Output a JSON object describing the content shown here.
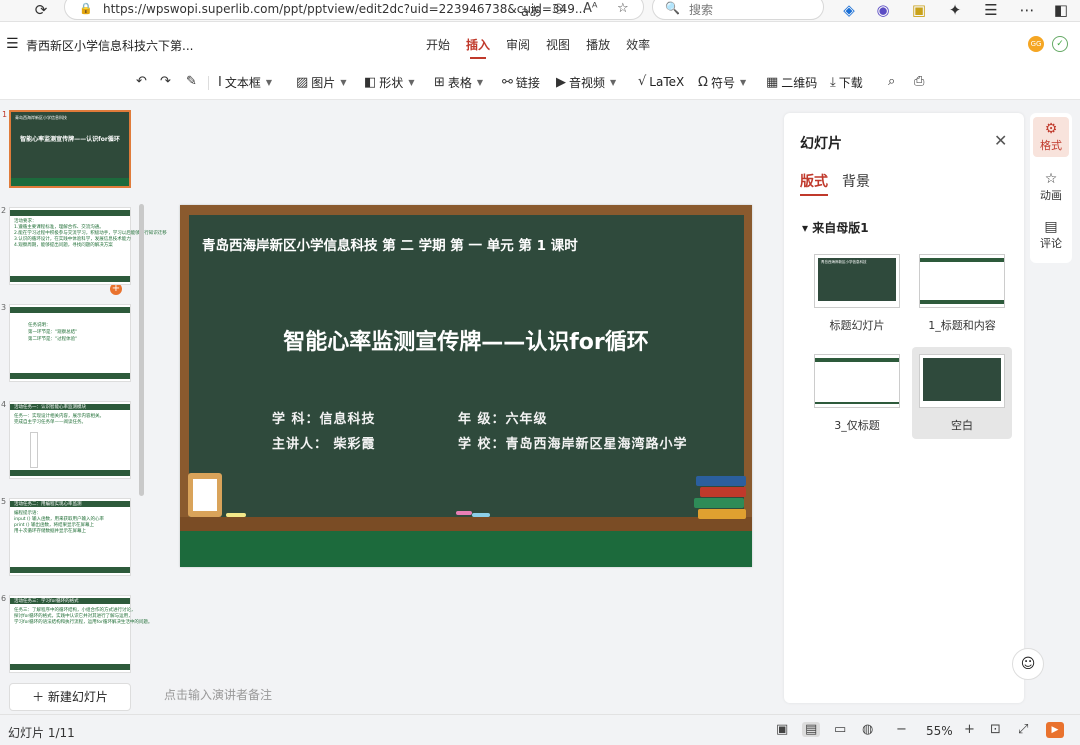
{
  "browser": {
    "url": "https://wpswopi.superlib.com/ppt/pptview/edit2dc?uid=223946738&cuid=349...",
    "search_placeholder": "搜索",
    "read_aloud": "aあ"
  },
  "app": {
    "doc_title": "青西新区小学信息科技六下第...",
    "tabs": [
      {
        "label": "开始"
      },
      {
        "label": "插入"
      },
      {
        "label": "审阅"
      },
      {
        "label": "视图"
      },
      {
        "label": "播放"
      },
      {
        "label": "效率"
      }
    ],
    "active_tab": "插入",
    "avatar_text": "GG"
  },
  "toolbar": {
    "textbox": "文本框",
    "image": "图片",
    "shape": "形状",
    "table": "表格",
    "link": "链接",
    "media": "音视频",
    "latex": "LaTeX",
    "symbol": "符号",
    "qrcode": "二维码",
    "download": "下载"
  },
  "thumbnails": {
    "slide1_title": "智能心率监测宣传牌——认识for循环",
    "slide1_header": "青岛西海岸新区小学信息科技",
    "slide2_lines": [
      "活动要求：",
      "1.遵循主要课程标准，理解合作、交流沟通。",
      "2.能在学习过程中积极参与交流学习，积极动手，学习以后能够进行知识迁移",
      "3.认识的循环设计，在实践中体验科学，发展信息技术能力",
      "4.观察周期，能够提出问题，寻找问题的解决方案"
    ],
    "slide3_lines": [
      "任务说明：",
      "第一环节是：\"观察总结\"",
      "第二环节是：\"过程体验\""
    ],
    "slide4_lines": [
      "活动任务一：认识智能心率监测模块",
      "任务一：实现设计相关内容，展示内容相关。",
      "完成自主学习任务单——阅读任务。"
    ],
    "slide5_lines": [
      "活动任务二：用编程实现心率监测",
      "编程提示语：",
      "input () 输入函数，用来获取用户输入的心率",
      "print () 输出函数，将结果显示在屏幕上",
      "用十次循环存储数据并显示在屏幕上"
    ],
    "slide6_lines": [
      "活动任务三：学习for循环的格式",
      "任务三：了解程序中的循环结构，小组合作的方式进行讨论，",
      "探讨for循环的格式，实践中认识它并对其进行了解与运用，",
      "学习for循环的语法结构和执行流程，运用for循环解决生活中的问题。"
    ],
    "new_slide": "新建幻灯片"
  },
  "slide": {
    "header": "青岛西海岸新区小学信息科技     第 二 学期     第 一 单元     第 1 课时",
    "title": "智能心率监测宣传牌——认识for循环",
    "subject": "学  科：信息科技",
    "grade": "年 级：六年级",
    "speaker": "主讲人：  柴彩霞",
    "school": "学 校：青岛西海岸新区星海湾路小学"
  },
  "notes_placeholder": "点击输入演讲者备注",
  "right_panel": {
    "title": "幻灯片",
    "tab_layout": "版式",
    "tab_background": "背景",
    "section": "来自母版1",
    "layouts": [
      {
        "label": "标题幻灯片"
      },
      {
        "label": "1_标题和内容"
      },
      {
        "label": "3_仅标题"
      },
      {
        "label": "空白"
      }
    ],
    "layout_thumb_text": "青岛西海岸新区小学信息科技"
  },
  "rail": {
    "format": "格式",
    "animation": "动画",
    "comment": "评论"
  },
  "status": {
    "page": "幻灯片 1/11",
    "zoom": "55%"
  },
  "colors": {
    "accent": "#c0392b",
    "board_green": "#2f4a3c",
    "board_frame": "#8a5a2e",
    "floor_green": "#1c6a3c"
  }
}
